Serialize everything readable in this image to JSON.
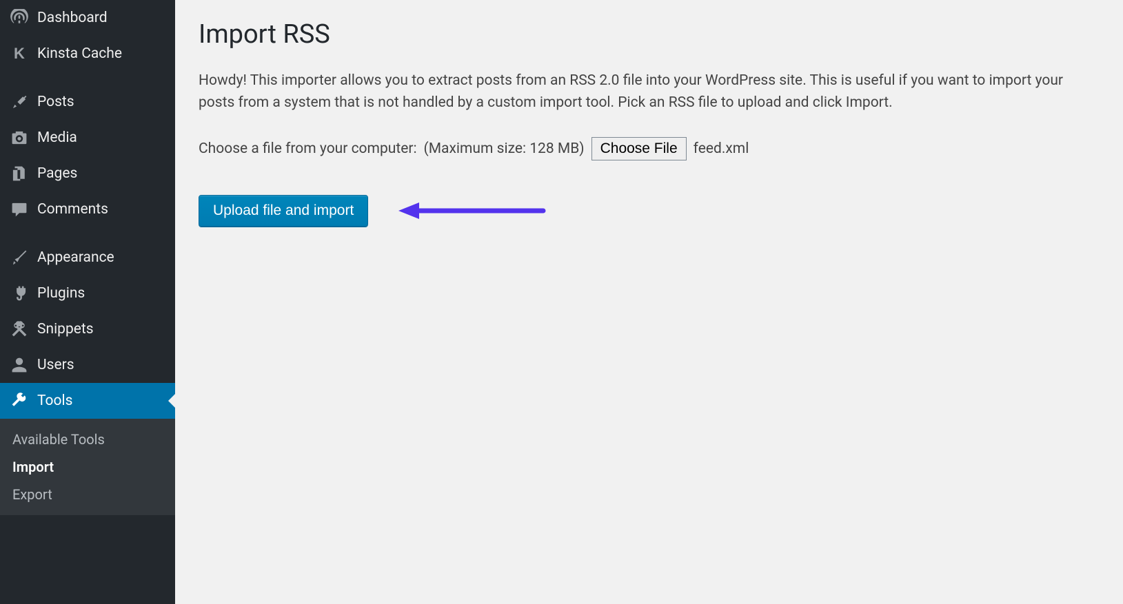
{
  "sidebar": {
    "items": [
      {
        "label": "Dashboard",
        "icon": "gauge-icon"
      },
      {
        "label": "Kinsta Cache",
        "icon": "k-letter-icon"
      },
      {
        "label": "Posts",
        "icon": "pin-icon"
      },
      {
        "label": "Media",
        "icon": "camera-icon"
      },
      {
        "label": "Pages",
        "icon": "pages-icon"
      },
      {
        "label": "Comments",
        "icon": "comment-icon"
      },
      {
        "label": "Appearance",
        "icon": "brush-icon"
      },
      {
        "label": "Plugins",
        "icon": "plug-icon"
      },
      {
        "label": "Snippets",
        "icon": "scissors-icon"
      },
      {
        "label": "Users",
        "icon": "user-icon"
      },
      {
        "label": "Tools",
        "icon": "wrench-icon",
        "active": true
      }
    ],
    "submenu": [
      {
        "label": "Available Tools"
      },
      {
        "label": "Import",
        "current": true
      },
      {
        "label": "Export"
      }
    ]
  },
  "page": {
    "title": "Import RSS",
    "description": "Howdy! This importer allows you to extract posts from an RSS 2.0 file into your WordPress site. This is useful if you want to import your posts from a system that is not handled by a custom import tool. Pick an RSS file to upload and click Import.",
    "choose_label": "Choose a file from your computer:",
    "max_label": "(Maximum size: 128 MB)",
    "choose_button": "Choose File",
    "file_selected": "feed.xml",
    "upload_button": "Upload file and import"
  },
  "colors": {
    "accent": "#0073aa",
    "annotation": "#5333ed"
  }
}
